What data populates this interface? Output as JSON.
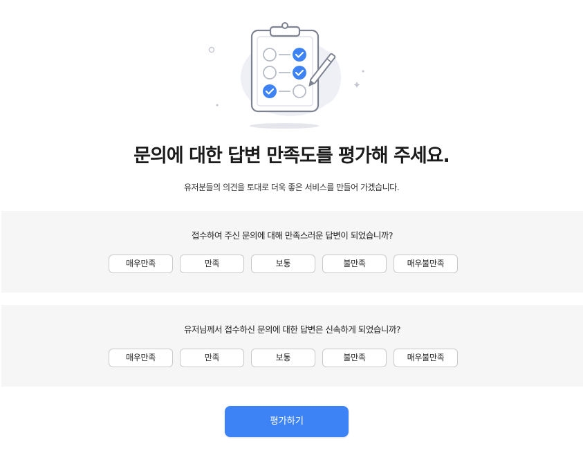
{
  "hero": {
    "icon": "checklist-clipboard-icon"
  },
  "header": {
    "title": "문의에 대한 답변 만족도를 평가해 주세요.",
    "subtitle": "유저분들의 의견을 토대로 더욱 좋은 서비스를 만들어 가겠습니다."
  },
  "questions": [
    {
      "text": "접수하여 주신 문의에 대해 만족스러운 답변이 되었습니까?",
      "options": [
        "매우만족",
        "만족",
        "보통",
        "불만족",
        "매우불만족"
      ]
    },
    {
      "text": "유저님께서 접수하신 문의에 대한 답변은 신속하게 되었습니까?",
      "options": [
        "매우만족",
        "만족",
        "보통",
        "불만족",
        "매우불만족"
      ]
    }
  ],
  "submit": {
    "label": "평가하기"
  },
  "colors": {
    "accent": "#3d83f5",
    "panel": "#f6f6f6",
    "border": "#c9c9c9"
  }
}
